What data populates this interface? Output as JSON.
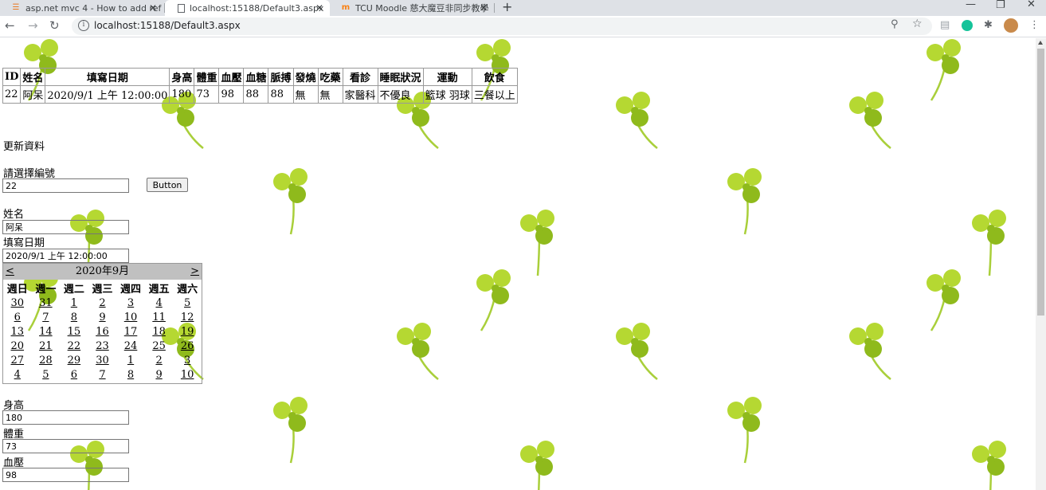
{
  "browser": {
    "tabs": [
      {
        "title": "asp.net mvc 4 - How to add ref",
        "active": false
      },
      {
        "title": "localhost:15188/Default3.aspx",
        "active": true
      },
      {
        "title": "TCU Moodle 慈大魔豆非同步教學",
        "active": false
      }
    ],
    "new_tab": "+",
    "close_glyph": "✕",
    "address": "localhost:15188/Default3.aspx"
  },
  "table": {
    "headers": [
      "ID",
      "姓名",
      "填寫日期",
      "身高",
      "體重",
      "血壓",
      "血糖",
      "脈搏",
      "發燒",
      "吃藥",
      "看診",
      "睡眠狀況",
      "運動",
      "飲食"
    ],
    "rows": [
      [
        "22",
        "阿呆",
        "2020/9/1 上午 12:00:00",
        "180",
        "73",
        "98",
        "88",
        "88",
        "無",
        "無",
        "家醫科",
        "不優良",
        "籃球 羽球",
        "三餐以上"
      ]
    ]
  },
  "form": {
    "section_title": "更新資料",
    "select_id_label": "請選擇編號",
    "select_id_value": "22",
    "button_label": "Button",
    "name_label": "姓名",
    "name_value": "阿呆",
    "date_label": "填寫日期",
    "date_value": "2020/9/1 上午 12:00:00",
    "height_label": "身高",
    "height_value": "180",
    "weight_label": "體重",
    "weight_value": "73",
    "bp_label": "血壓",
    "bp_value": "98"
  },
  "calendar": {
    "prev": "<",
    "next": ">",
    "title": "2020年9月",
    "weekdays": [
      "週日",
      "週一",
      "週二",
      "週三",
      "週四",
      "週五",
      "週六"
    ],
    "weeks": [
      [
        "30",
        "31",
        "1",
        "2",
        "3",
        "4",
        "5"
      ],
      [
        "6",
        "7",
        "8",
        "9",
        "10",
        "11",
        "12"
      ],
      [
        "13",
        "14",
        "15",
        "16",
        "17",
        "18",
        "19"
      ],
      [
        "20",
        "21",
        "22",
        "23",
        "24",
        "25",
        "26"
      ],
      [
        "27",
        "28",
        "29",
        "30",
        "1",
        "2",
        "3"
      ],
      [
        "4",
        "5",
        "6",
        "7",
        "8",
        "9",
        "10"
      ]
    ]
  },
  "colors": {
    "clover": "#b5d832",
    "clover_dark": "#8fba1c",
    "stem": "#a9cf3a"
  }
}
